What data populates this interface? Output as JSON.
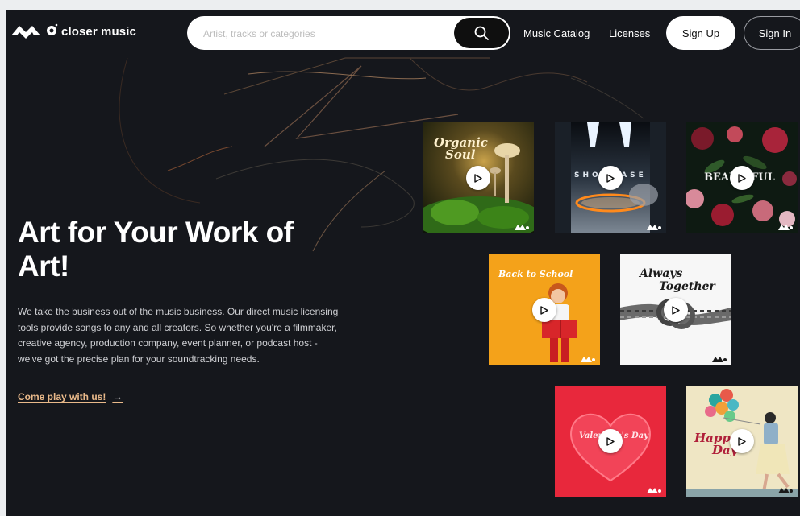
{
  "header": {
    "logo_text": "closer music",
    "search_placeholder": "Artist, tracks or categories",
    "nav": [
      "Music Catalog",
      "Licenses"
    ],
    "signup_label": "Sign Up",
    "signin_label": "Sign In"
  },
  "hero": {
    "title_line1": "Art for Your Work of",
    "title_line2": "Art!",
    "description": "We take the business out of the music business. Our direct music licensing tools provide songs to any and all creators. So whether you're a filmmaker, creative agency, production company, event planner, or podcast host - we've got the precise plan for your soundtracking needs.",
    "cta": "Come play with us!",
    "cta_arrow": "→"
  },
  "playlists": [
    {
      "title_line1": "Organic",
      "title_line2": "Soul"
    },
    {
      "title": "SHOWCASE"
    },
    {
      "title": "BEAUTIFUL"
    },
    {
      "title": "Back to School"
    },
    {
      "title_line1": "Always",
      "title_line2": "Together"
    },
    {
      "title": "Valentine's Day"
    },
    {
      "title_line1": "Happy",
      "title_line2": "Day"
    }
  ],
  "icons": {
    "search": "search-icon",
    "play": "play-icon",
    "logo": "cm-logo-icon"
  },
  "colors": {
    "background": "#15171c",
    "accent_link": "#e9b98a",
    "button_dark": "#0f0f0f"
  }
}
